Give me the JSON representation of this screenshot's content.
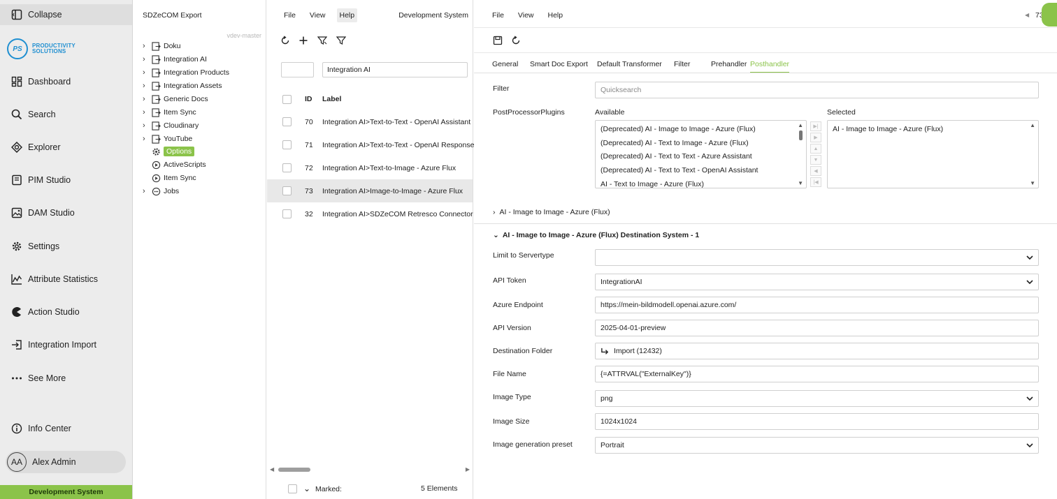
{
  "nav": {
    "collapse": "Collapse",
    "logo_initials": "PS",
    "logo_line1": "PRODUCTIVITY",
    "logo_line2": "SOLUTIONS",
    "items": [
      {
        "label": "Dashboard",
        "icon": "dashboard-icon"
      },
      {
        "label": "Search",
        "icon": "search-icon"
      },
      {
        "label": "Explorer",
        "icon": "explorer-icon"
      },
      {
        "label": "PIM Studio",
        "icon": "pim-studio-icon"
      },
      {
        "label": "DAM Studio",
        "icon": "image-icon"
      },
      {
        "label": "Settings",
        "icon": "gear-icon"
      },
      {
        "label": "Attribute Statistics",
        "icon": "chart-icon"
      },
      {
        "label": "Action Studio",
        "icon": "pacman-icon"
      },
      {
        "label": "Integration Import",
        "icon": "import-icon"
      },
      {
        "label": "See More",
        "icon": "more-icon"
      }
    ],
    "info_center": "Info Center",
    "user_initials": "AA",
    "user_name": "Alex Admin",
    "environment": "Development System"
  },
  "tree": {
    "title": "SDZeCOM Export",
    "branch": "vdev-master",
    "nodes": [
      {
        "label": "Doku"
      },
      {
        "label": "Integration AI"
      },
      {
        "label": "Integration Products"
      },
      {
        "label": "Integration Assets"
      },
      {
        "label": "Generic Docs"
      },
      {
        "label": "Item Sync"
      },
      {
        "label": "Cloudinary"
      },
      {
        "label": "YouTube"
      },
      {
        "label": "Options"
      },
      {
        "label": "ActiveScripts"
      },
      {
        "label": "Item Sync"
      },
      {
        "label": "Jobs"
      }
    ]
  },
  "list": {
    "menu": [
      "File",
      "View",
      "Help"
    ],
    "system": "Development System",
    "filter_value": "Integration AI",
    "col_id": "ID",
    "col_label": "Label",
    "rows": [
      {
        "id": "70",
        "label": "Integration AI>Text-to-Text - OpenAI Assistant"
      },
      {
        "id": "71",
        "label": "Integration AI>Text-to-Text - OpenAI Response"
      },
      {
        "id": "72",
        "label": "Integration AI>Text-to-Image - Azure Flux"
      },
      {
        "id": "73",
        "label": "Integration AI>Image-to-Image - Azure Flux"
      },
      {
        "id": "32",
        "label": "Integration AI>SDZeCOM Retresco Connector"
      }
    ],
    "marked": "Marked:",
    "count": "5 Elements"
  },
  "detail": {
    "menu": [
      "File",
      "View",
      "Help"
    ],
    "corner_id": "73",
    "tabs": [
      "General",
      "Smart Doc Export",
      "Default Transformer",
      "Filter",
      "Prehandler",
      "Posthandler"
    ],
    "active_tab": "Posthandler",
    "filter_label": "Filter",
    "filter_placeholder": "Quicksearch",
    "plugins_label": "PostProcessorPlugins",
    "available_label": "Available",
    "selected_label": "Selected",
    "available": [
      "(Deprecated) AI - Image to Image - Azure (Flux)",
      "(Deprecated) AI - Text to Image - Azure (Flux)",
      "(Deprecated) AI - Text to Text - Azure Assistant",
      "(Deprecated) AI - Text to Text - OpenAI Assistant",
      "AI - Text to Image - Azure (Flux)"
    ],
    "selected": [
      "AI - Image to Image - Azure (Flux)"
    ],
    "section_collapsed": "AI - Image to Image - Azure (Flux)",
    "section_expanded": "AI - Image to Image - Azure (Flux) Destination System - 1",
    "fields": {
      "limit_label": "Limit to Servertype",
      "limit_value": "",
      "token_label": "API Token",
      "token_value": "IntegrationAI",
      "endpoint_label": "Azure Endpoint",
      "endpoint_value": "https://mein-bildmodell.openai.azure.com/",
      "version_label": "API Version",
      "version_value": "2025-04-01-preview",
      "folder_label": "Destination Folder",
      "folder_value": "Import (12432)",
      "filename_label": "File Name",
      "filename_value": "{=ATTRVAL(\"ExternalKey\")}",
      "imgtype_label": "Image Type",
      "imgtype_value": "png",
      "imgsize_label": "Image Size",
      "imgsize_value": "1024x1024",
      "preset_label": "Image generation preset",
      "preset_value": "Portrait"
    }
  }
}
